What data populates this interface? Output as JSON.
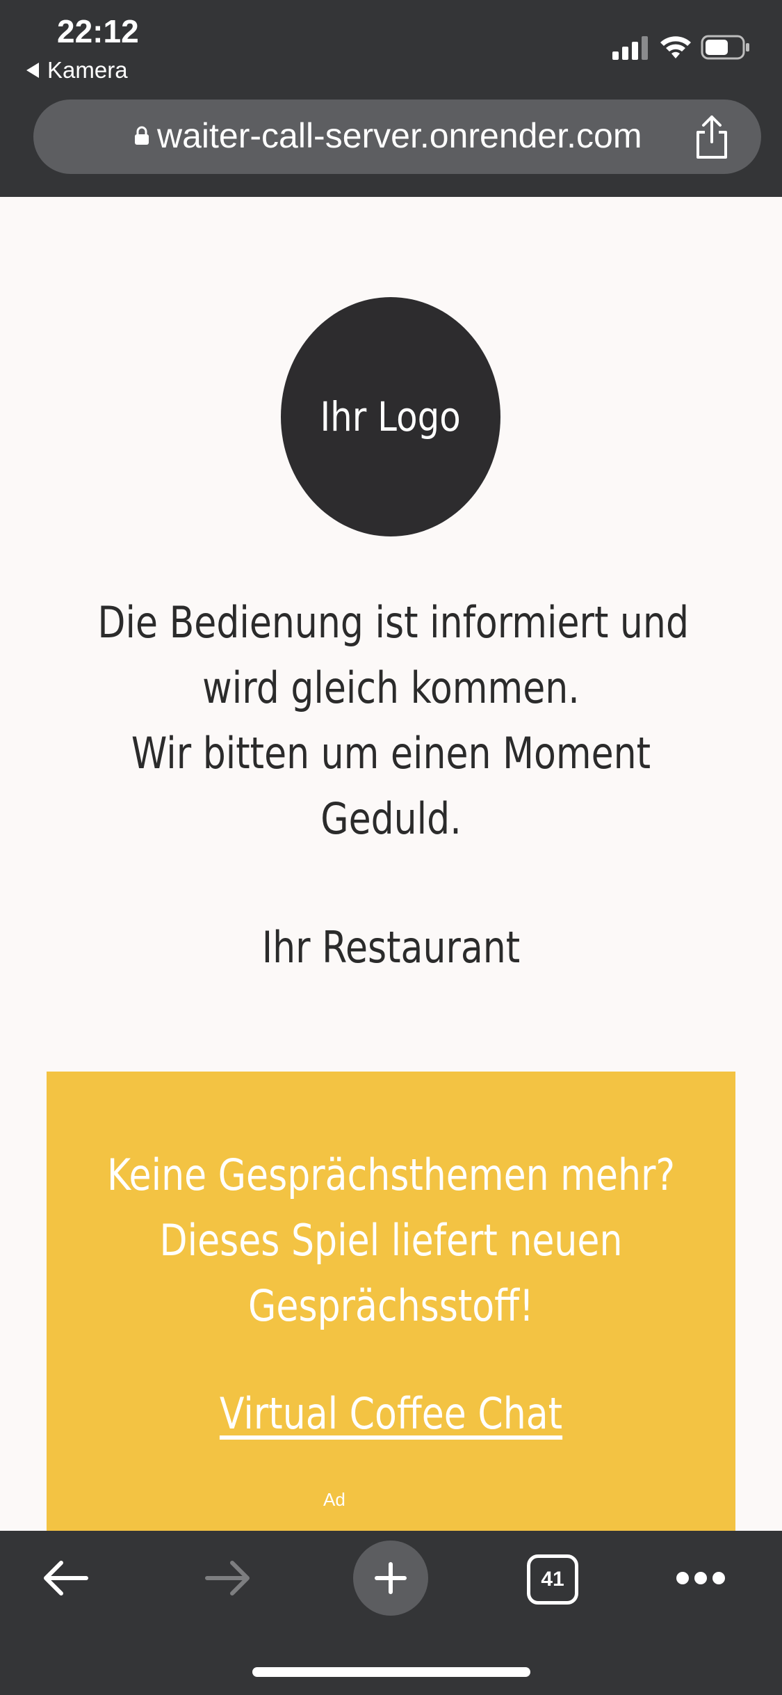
{
  "status_bar": {
    "time": "22:12",
    "back_app": "Kamera",
    "icons": [
      "signal-icon",
      "wifi-icon",
      "battery-icon"
    ]
  },
  "address_bar": {
    "url": "waiter-call-server.onrender.com",
    "icons": [
      "lock-icon",
      "share-icon"
    ]
  },
  "content": {
    "logo_text": "Ihr Logo",
    "message_lines": [
      "Die Bedienung ist informiert und",
      "wird gleich kommen.",
      "Wir bitten um einen Moment",
      "Geduld."
    ],
    "signature": "Ihr Restaurant"
  },
  "ad": {
    "headline_lines": [
      "Keine Gesprächsthemen mehr?",
      "Dieses Spiel liefert neuen",
      "Gesprächsstoff!"
    ],
    "link_text": "Virtual Coffee Chat",
    "label": "Ad",
    "background_color": "#f3c343"
  },
  "toolbar": {
    "tab_count": "41",
    "icons": [
      "back-arrow-icon",
      "forward-arrow-icon",
      "new-tab-plus-icon",
      "tabs-icon",
      "more-dots-icon"
    ]
  },
  "colors": {
    "chrome": "#343537",
    "url_bar": "#5d5e61",
    "page_background": "#fcf9f8",
    "logo_circle": "#2d2c2e",
    "text": "#2b2b2b"
  }
}
